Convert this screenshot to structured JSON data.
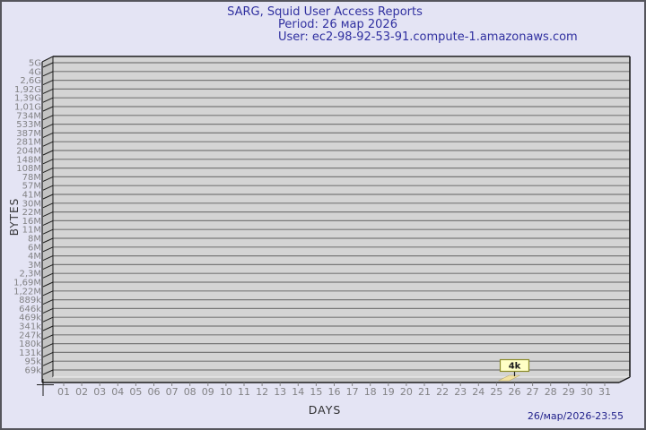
{
  "header": {
    "title": "SARG, Squid User Access Reports",
    "period": "Period: 26 мар 2026",
    "user": "User: ec2-98-92-53-91.compute-1.amazonaws.com"
  },
  "footer": {
    "timestamp": "26/мар/2026-23:55"
  },
  "colors": {
    "background": "#e4e4f4",
    "outer_border": "#55555c",
    "title_text": "#3030a0",
    "timestamp_text": "#1f1f8a",
    "plot_face": "#d4d4d4",
    "plot_side_face": "#c3c3c3",
    "gridline": "#787878",
    "box_edge": "#1c1c1c",
    "bottom_highlight": "#ececec",
    "tick_label": "#828284",
    "axis_label": "#38383a",
    "flag_fill": "#ffffc6",
    "flag_border": "#8b8b2a",
    "flag_text": "#1a1a1a",
    "bar_fill": "#f2e2a2",
    "bar_edge": "#b8a868"
  },
  "chart_data": {
    "type": "bar",
    "title": "SARG, Squid User Access Reports",
    "subtitle_period": "Period: 26 мар 2026",
    "subtitle_user": "User: ec2-98-92-53-91.compute-1.amazonaws.com",
    "xlabel": "DAYS",
    "ylabel": "BYTES",
    "scale": "log",
    "grid": "horizontal",
    "legend_position": "none",
    "y_tick_labels": [
      "5G",
      "4G",
      "2,6G",
      "1,92G",
      "1,39G",
      "1,01G",
      "734M",
      "533M",
      "387M",
      "281M",
      "204M",
      "148M",
      "108M",
      "78M",
      "57M",
      "41M",
      "30M",
      "22M",
      "16M",
      "11M",
      "8M",
      "6M",
      "4M",
      "3M",
      "2,3M",
      "1,69M",
      "1,22M",
      "889k",
      "646k",
      "469k",
      "341k",
      "247k",
      "180k",
      "131k",
      "95k",
      "69k"
    ],
    "x_tick_labels": [
      "01",
      "02",
      "03",
      "04",
      "05",
      "06",
      "07",
      "08",
      "09",
      "10",
      "11",
      "12",
      "13",
      "14",
      "15",
      "16",
      "17",
      "18",
      "19",
      "20",
      "21",
      "22",
      "23",
      "24",
      "25",
      "26",
      "27",
      "28",
      "29",
      "30",
      "31"
    ],
    "points": [
      {
        "day": "26",
        "value_label": "4k",
        "value_bytes": 4096
      }
    ]
  }
}
